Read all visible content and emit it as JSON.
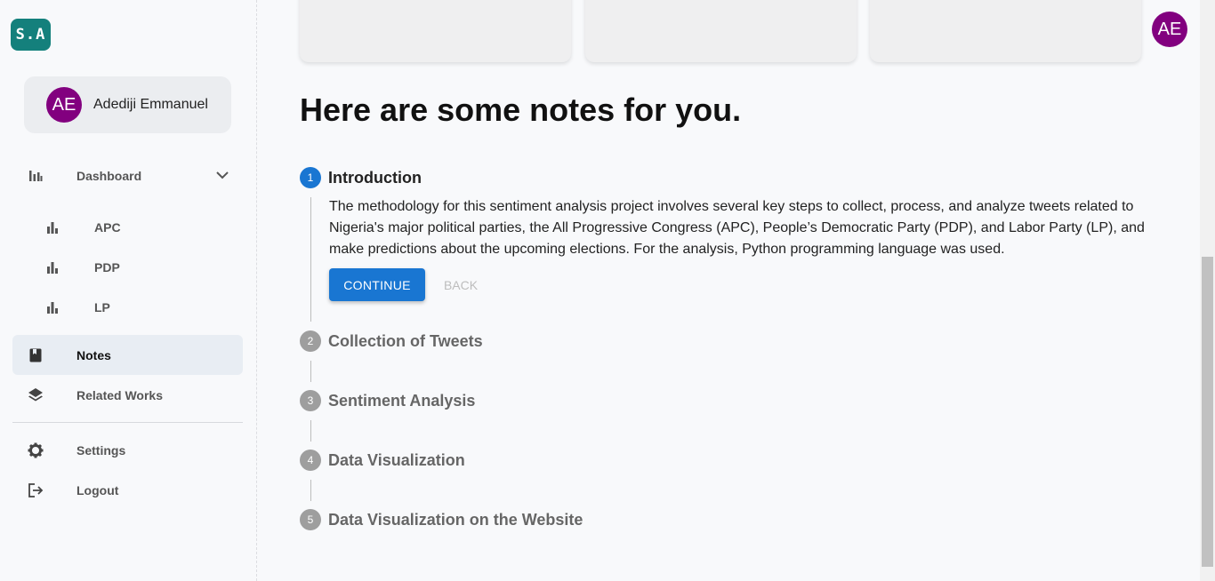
{
  "sidebar": {
    "logo": "S.A",
    "user": {
      "initials": "AE",
      "name": "Adediji Emmanuel"
    },
    "items": {
      "dashboard": {
        "label": "Dashboard",
        "icon": "bar-chart-icon"
      },
      "apc": {
        "label": "APC",
        "icon": "bar-chart-icon"
      },
      "pdp": {
        "label": "PDP",
        "icon": "bar-chart-icon"
      },
      "lp": {
        "label": "LP",
        "icon": "bar-chart-icon"
      },
      "notes": {
        "label": "Notes",
        "icon": "book-icon",
        "active": true
      },
      "related": {
        "label": "Related Works",
        "icon": "layers-icon"
      },
      "settings": {
        "label": "Settings",
        "icon": "gear-icon"
      },
      "logout": {
        "label": "Logout",
        "icon": "logout-icon"
      }
    }
  },
  "header": {
    "avatar_initials": "AE"
  },
  "main": {
    "heading": "Here are some notes for you.",
    "steps": [
      {
        "num": "1",
        "title": "Introduction",
        "active": true
      },
      {
        "num": "2",
        "title": "Collection of Tweets"
      },
      {
        "num": "3",
        "title": "Sentiment Analysis"
      },
      {
        "num": "4",
        "title": "Data Visualization"
      },
      {
        "num": "5",
        "title": "Data Visualization on the Website"
      }
    ],
    "intro_text": "The methodology for this sentiment analysis project involves several key steps to collect, process, and analyze tweets related to Nigeria's major political parties, the All Progressive Congress (APC), People’s Democratic Party (PDP), and Labor Party (LP), and make predictions about the upcoming elections. For the analysis, Python programming language was used.",
    "continue_label": "CONTINUE",
    "back_label": "BACK"
  },
  "colors": {
    "accent": "#1976d2",
    "avatar": "#82007f",
    "logo": "#14807c"
  }
}
